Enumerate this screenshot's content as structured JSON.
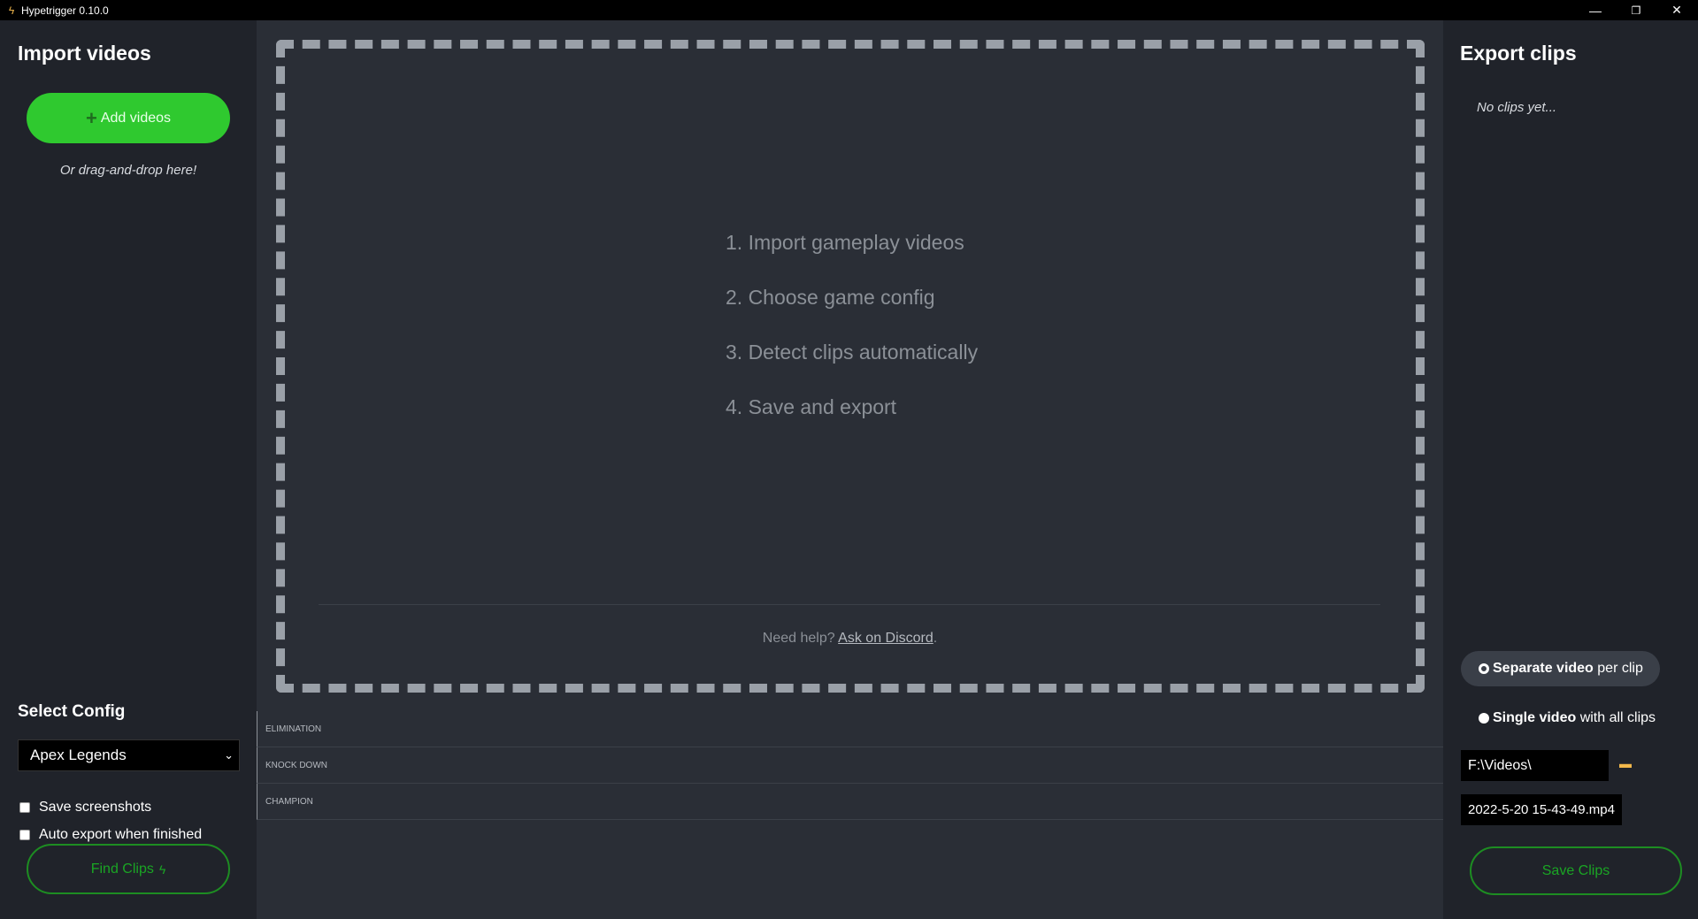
{
  "window": {
    "title": "Hypetrigger 0.10.0",
    "controls": {
      "minimize": "—",
      "restore": "❐",
      "close": "✕"
    }
  },
  "left": {
    "heading": "Import videos",
    "add_button": "Add videos",
    "dnd_hint": "Or drag-and-drop here!",
    "config_heading": "Select Config",
    "config_selected": "Apex Legends",
    "checkboxes": [
      "Save screenshots",
      "Auto export when finished"
    ],
    "find_button": "Find Clips"
  },
  "center": {
    "steps": [
      "1. Import gameplay videos",
      "2. Choose game config",
      "3. Detect clips automatically",
      "4. Save and export"
    ],
    "help_prefix": "Need help?",
    "help_link": "Ask on Discord",
    "help_suffix": ".",
    "events": [
      "ELIMINATION",
      "KNOCK DOWN",
      "CHAMPION"
    ]
  },
  "right": {
    "heading": "Export clips",
    "empty_text": "No clips yet...",
    "option_separate_bold": "Separate video",
    "option_separate_rest": " per clip",
    "option_single_bold": "Single video",
    "option_single_rest": " with all clips",
    "path": "F:\\Videos\\",
    "filename": "2022-5-20 15-43-49.mp4",
    "save_button": "Save Clips"
  },
  "colors": {
    "accent": "#2fc92f",
    "accent_dark": "#1d8d22",
    "panel": "#20232a",
    "background": "#2a2e36"
  }
}
